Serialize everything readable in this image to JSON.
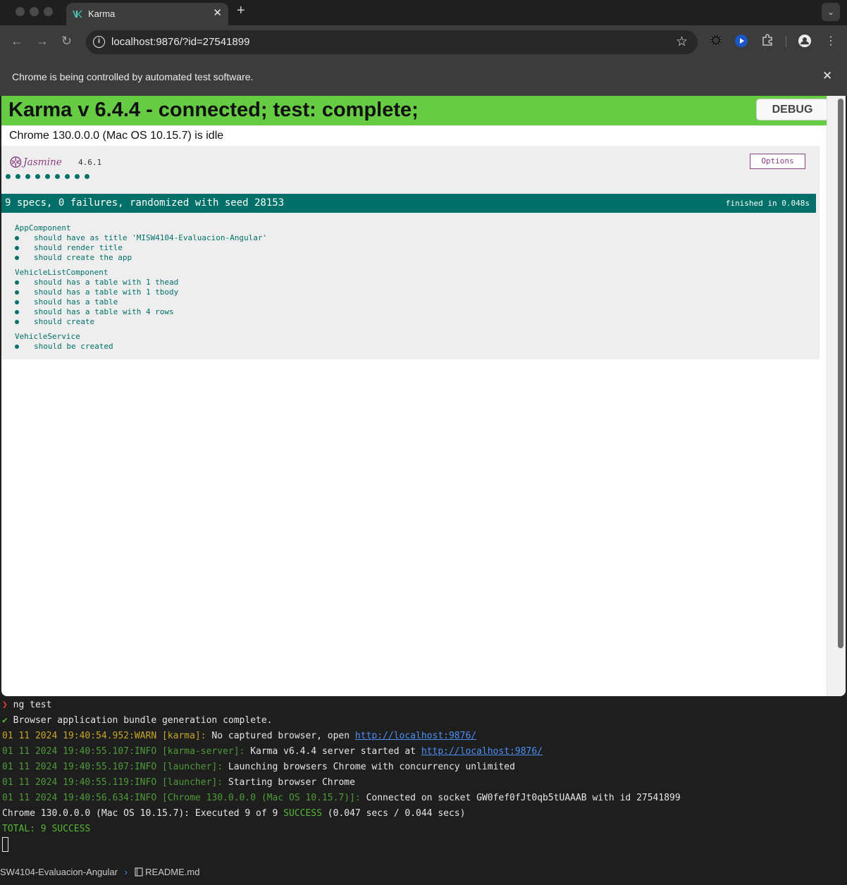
{
  "tab": {
    "title": "Karma",
    "favicon": "karma-k-icon"
  },
  "address_bar": {
    "url": "localhost:9876/?id=27541899"
  },
  "infobar": {
    "text": "Chrome is being controlled by automated test software."
  },
  "karma": {
    "banner": "Karma v 6.4.4 - connected; test: complete;",
    "debug_label": "DEBUG",
    "browser_status": "Chrome 130.0.0.0 (Mac OS 10.15.7) is idle",
    "banner_color": "#66cc44"
  },
  "jasmine": {
    "logo_text": "Jasmine",
    "version": "4.6.1",
    "options_label": "Options",
    "spec_dots": 9,
    "summary": "9 specs, 0 failures, randomized with seed 28153",
    "duration": "finished in 0.048s",
    "accent_color": "#007069",
    "suites": [
      {
        "name": "AppComponent",
        "specs": [
          "should have as title 'MISW4104-Evaluacion-Angular'",
          "should render title",
          "should create the app"
        ]
      },
      {
        "name": "VehicleListComponent",
        "specs": [
          "should has a table with 1 thead",
          "should has a table with 1 tbody",
          "should has a table",
          "should has a table with 4 rows",
          "should create"
        ]
      },
      {
        "name": "VehicleService",
        "specs": [
          "should be created"
        ]
      }
    ]
  },
  "terminal": {
    "prompt_symbol": "❯",
    "command": "ng test",
    "check_symbol": "✔",
    "bundle_line": "Browser application bundle generation complete.",
    "log1": {
      "prefix": "01 11 2024 19:40:54.952:WARN [karma]:",
      "text": "No captured browser, open",
      "link": "http://localhost:9876/"
    },
    "log2": {
      "prefix": "01 11 2024 19:40:55.107:INFO [karma-server]:",
      "text": "Karma v6.4.4 server started at",
      "link": "http://localhost:9876/"
    },
    "log3": {
      "prefix": "01 11 2024 19:40:55.107:INFO [launcher]:",
      "text": "Launching browsers Chrome with concurrency unlimited"
    },
    "log4": {
      "prefix": "01 11 2024 19:40:55.119:INFO [launcher]:",
      "text": "Starting browser Chrome"
    },
    "log5": {
      "prefix": "01 11 2024 19:40:56.634:INFO [Chrome 130.0.0.0 (Mac OS 10.15.7)]:",
      "text": "Connected on socket GW0fef0fJt0qb5tUAAAB with id 27541899"
    },
    "exec": {
      "pre": "Chrome 130.0.0.0 (Mac OS 10.15.7): Executed 9 of 9",
      "status": "SUCCESS",
      "post": "(0.047 secs / 0.044 secs)"
    },
    "total": "TOTAL: 9 SUCCESS",
    "status_bar": {
      "path": "SW4104-Evaluacion-Angular",
      "separator": "›",
      "file_icon": "book-icon",
      "file": "README.md"
    }
  }
}
